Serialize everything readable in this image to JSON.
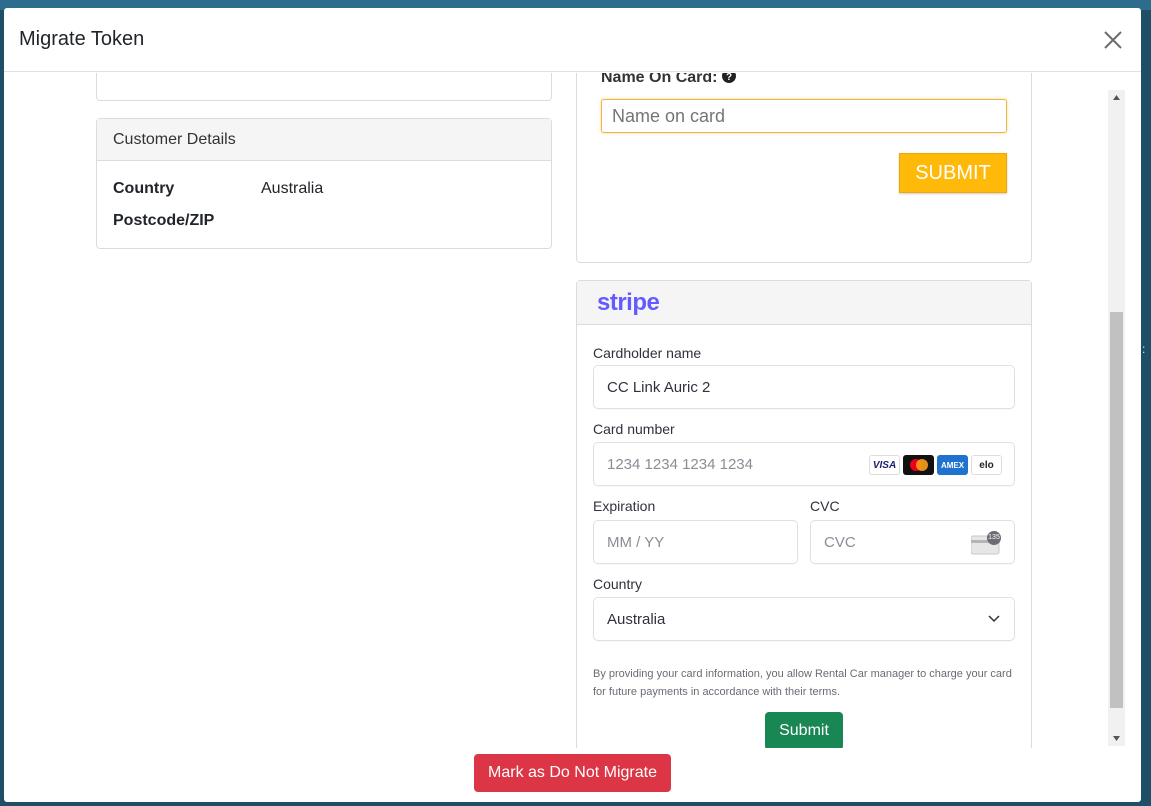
{
  "modal": {
    "title": "Migrate Token",
    "close_icon": "close-icon"
  },
  "customer_details": {
    "heading": "Customer Details",
    "rows": [
      {
        "label": "Country",
        "value": "Australia"
      },
      {
        "label": "Postcode/ZIP",
        "value": ""
      }
    ]
  },
  "name_form": {
    "label": "Name On Card:",
    "help_icon": "question-circle-icon",
    "placeholder": "Name on card",
    "submit_label": "SUBMIT"
  },
  "stripe": {
    "logo": "stripe",
    "cardholder_label": "Cardholder name",
    "cardholder_value": "CC Link Auric 2",
    "card_number_label": "Card number",
    "card_number_placeholder": "1234 1234 1234 1234",
    "brands": [
      "VISA",
      "mastercard",
      "AMEX",
      "elo"
    ],
    "expiration_label": "Expiration",
    "expiration_placeholder": "MM / YY",
    "cvc_label": "CVC",
    "cvc_placeholder": "CVC",
    "cvc_badge": "135",
    "country_label": "Country",
    "country_value": "Australia",
    "terms": "By providing your card information, you allow Rental Car manager to charge your card for future payments in accordance with their terms.",
    "submit_label": "Submit"
  },
  "footer": {
    "mark_label": "Mark as Do Not Migrate"
  },
  "colors": {
    "stripe_brand": "#635bff",
    "submit_yellow": "#ffb909",
    "submit_green": "#198754",
    "danger": "#dc3545"
  }
}
